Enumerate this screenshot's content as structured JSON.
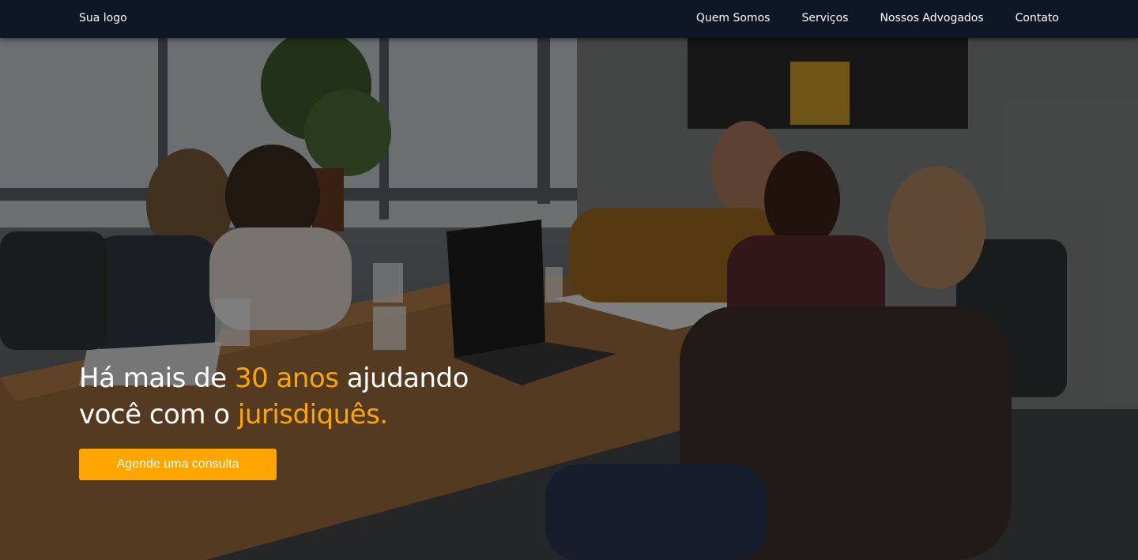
{
  "navbar": {
    "logo": "Sua logo",
    "links": [
      "Quem Somos",
      "Serviços",
      "Nossos Advogados",
      "Contato"
    ]
  },
  "hero": {
    "headline": {
      "part1": "Há mais de ",
      "accent1": "30 anos",
      "part2": " ajudando",
      "part3": "você com o ",
      "accent2": "jurisdiquês."
    },
    "cta_label": "Agende uma consulta"
  },
  "colors": {
    "navbar_bg": "#0f1626",
    "accent": "#ffa500",
    "text": "#ffffff"
  }
}
